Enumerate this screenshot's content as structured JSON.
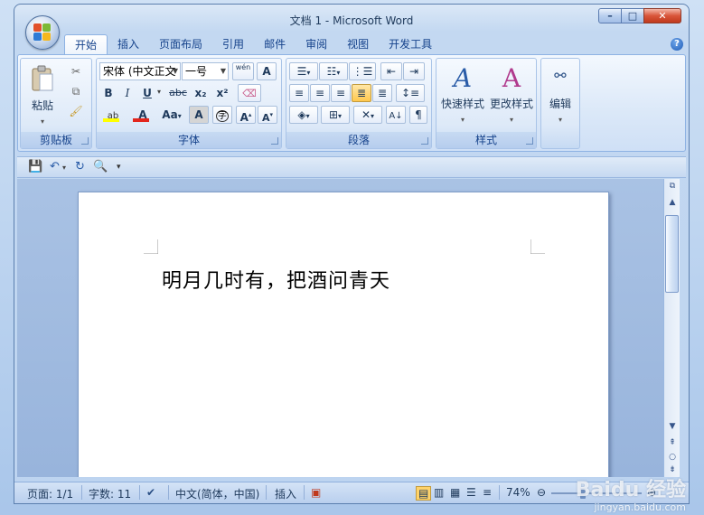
{
  "window": {
    "title": "文档 1 - Microsoft Word",
    "controls": {
      "minimize": "–",
      "maximize": "□",
      "close": "✕"
    }
  },
  "ribbon_tabs": [
    "开始",
    "插入",
    "页面布局",
    "引用",
    "邮件",
    "审阅",
    "视图",
    "开发工具"
  ],
  "active_tab": "开始",
  "help": "?",
  "groups": {
    "clipboard": {
      "label": "剪贴板",
      "paste": "粘贴"
    },
    "font": {
      "label": "字体",
      "font_name": "宋体 (中文正文",
      "font_size": "一号",
      "pinyin": "wén",
      "bold": "B",
      "italic": "I",
      "underline": "U",
      "strike": "abc",
      "subscript": "x₂",
      "superscript": "x²",
      "change_case": "Aa",
      "font_color": "A",
      "highlight": "ab",
      "char_shading": "A",
      "enclose": "字",
      "grow": "A",
      "shrink": "A",
      "border": "A"
    },
    "paragraph": {
      "label": "段落"
    },
    "styles": {
      "label": "样式",
      "quick_styles": "快速样式",
      "change_styles": "更改样式"
    },
    "editing": {
      "label": "编辑"
    }
  },
  "document": {
    "text": "明月几时有，把酒问青天"
  },
  "statusbar": {
    "page": "页面: 1/1",
    "words": "字数: 11",
    "language": "中文(简体，中国)",
    "mode": "插入",
    "zoom": "74%"
  },
  "watermark": {
    "brand": "Baidu 经验",
    "url": "jingyan.baidu.com"
  },
  "colors": {
    "font_color_bar": "#e3261d",
    "highlight_bar": "#ffff00",
    "close_button": "#c0391d"
  }
}
